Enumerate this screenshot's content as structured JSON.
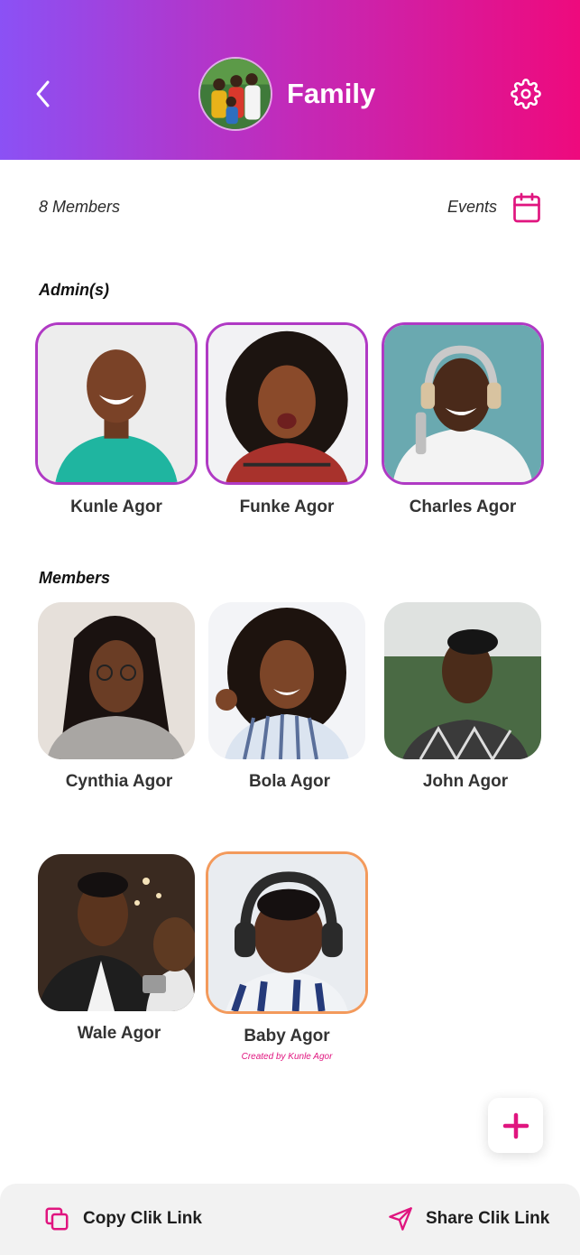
{
  "colors": {
    "accent": "#e0157f",
    "admin_border": "#b03ac4",
    "child_border": "#f39a5c",
    "gradient_start": "#8b51f5",
    "gradient_end": "#ee0a7d"
  },
  "header": {
    "title": "Family",
    "back_icon": "chevron-left-icon",
    "settings_icon": "gear-icon"
  },
  "info": {
    "members_count": "8 Members",
    "events_label": "Events",
    "events_icon": "calendar-icon"
  },
  "sections": {
    "admins_label": "Admin(s)",
    "members_label": "Members"
  },
  "admins": [
    {
      "name": "Kunle Agor"
    },
    {
      "name": "Funke Agor"
    },
    {
      "name": "Charles Agor"
    }
  ],
  "members": [
    {
      "name": "Cynthia Agor"
    },
    {
      "name": "Bola Agor"
    },
    {
      "name": "John Agor"
    },
    {
      "name": "Wale Agor"
    },
    {
      "name": "Baby Agor",
      "created_by": "Created by Kunle Agor"
    }
  ],
  "actions": {
    "add_icon": "plus-icon",
    "copy_label": "Copy Clik Link",
    "copy_icon": "copy-icon",
    "share_label": "Share Clik Link",
    "share_icon": "send-icon"
  }
}
